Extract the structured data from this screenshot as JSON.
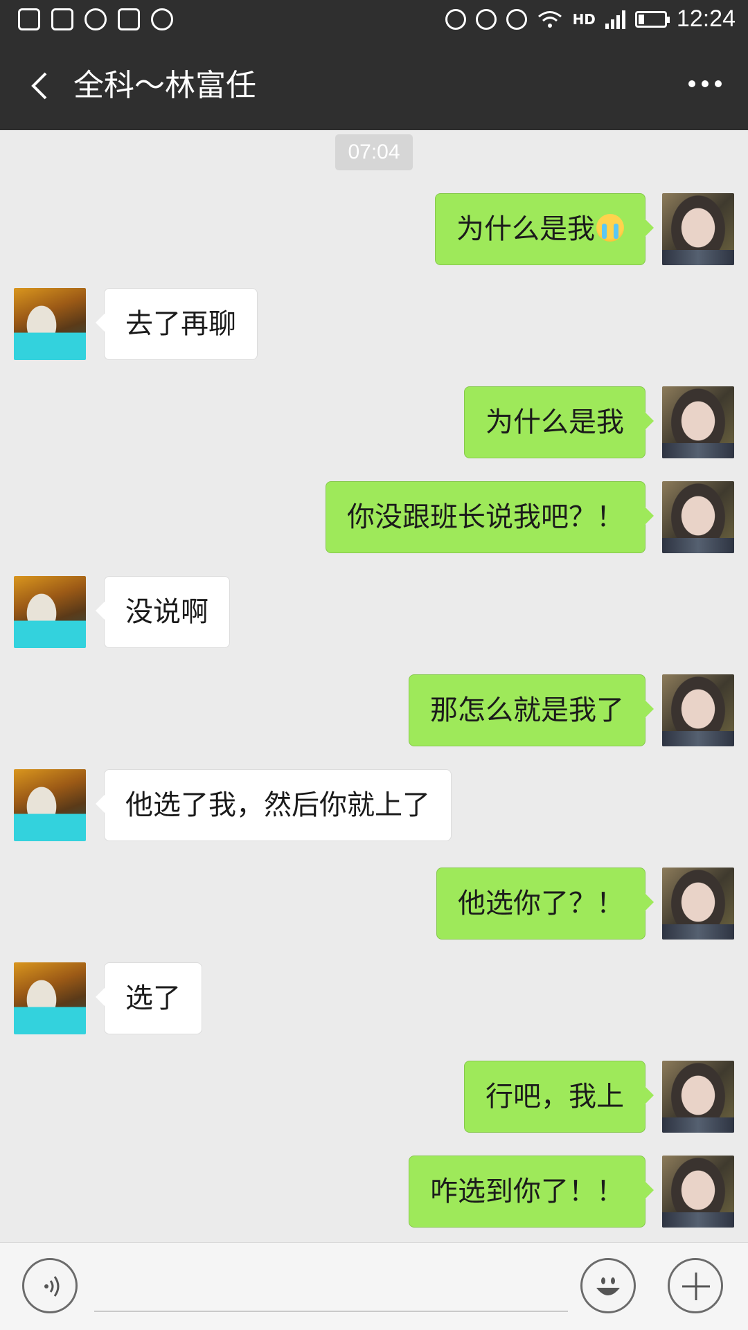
{
  "status_bar": {
    "time": "12:24",
    "network_label": "HD",
    "battery_level": 0.2,
    "left_icons": [
      "sd-card-icon",
      "s-app-icon",
      "sync-icon",
      "shield-icon",
      "more-circle-icon"
    ],
    "right_icons": [
      "mute-icon",
      "vibrate-off-icon",
      "alarm-icon",
      "wifi-icon",
      "signal-icon",
      "battery-icon"
    ]
  },
  "header": {
    "title": "全科～林富任",
    "back_icon": "back-arrow-icon",
    "more_icon": "more-dots-icon"
  },
  "chat": {
    "timestamp": "07:04",
    "messages": [
      {
        "sender": "me",
        "text": "为什么是我",
        "emoji": "crying-emoji"
      },
      {
        "sender": "friend",
        "text": "去了再聊"
      },
      {
        "sender": "me",
        "text": "为什么是我"
      },
      {
        "sender": "me",
        "text": "你没跟班长说我吧？！"
      },
      {
        "sender": "friend",
        "text": "没说啊"
      },
      {
        "sender": "me",
        "text": "那怎么就是我了"
      },
      {
        "sender": "friend",
        "text": "他选了我，然后你就上了"
      },
      {
        "sender": "me",
        "text": "他选你了？！"
      },
      {
        "sender": "friend",
        "text": "选了"
      },
      {
        "sender": "me",
        "text": "行吧，我上"
      },
      {
        "sender": "me",
        "text": "咋选到你了！！"
      }
    ]
  },
  "input_bar": {
    "placeholder": "",
    "voice_icon": "voice-icon",
    "emoji_icon": "smile-icon",
    "plus_icon": "plus-icon"
  },
  "colors": {
    "header_bg": "#2f2f2f",
    "chat_bg": "#ebebeb",
    "my_bubble": "#9ee95a",
    "friend_bubble": "#ffffff"
  }
}
